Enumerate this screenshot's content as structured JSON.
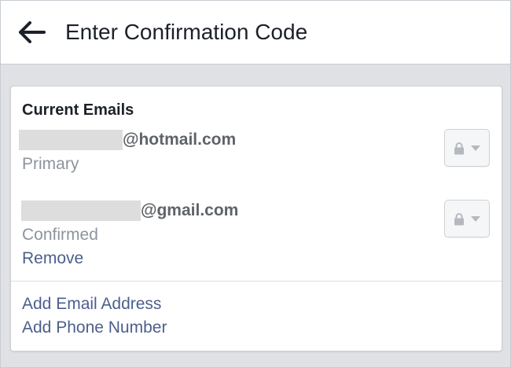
{
  "header": {
    "title": "Enter Confirmation Code",
    "back_icon": "arrow-left-icon"
  },
  "emails_section": {
    "title": "Current Emails",
    "emails": [
      {
        "domain": "@hotmail.com",
        "status": "Primary",
        "privacy_icon": "lock-icon"
      },
      {
        "domain": "@gmail.com",
        "status": "Confirmed",
        "action": "Remove",
        "privacy_icon": "lock-icon"
      }
    ]
  },
  "actions": {
    "add_email": "Add Email Address",
    "add_phone": "Add Phone Number"
  },
  "colors": {
    "link": "#4b5f8c",
    "muted": "#8d949e",
    "background": "#dfe1e5"
  }
}
